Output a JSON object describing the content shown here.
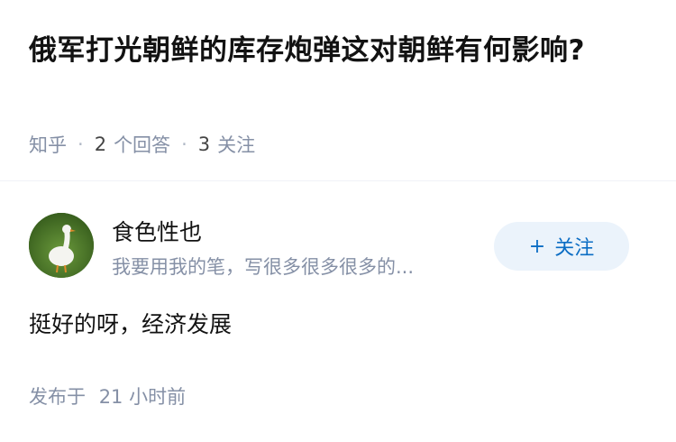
{
  "question": {
    "title": "俄军打光朝鲜的库存炮弹这对朝鲜有何影响?",
    "source": "知乎",
    "answer_count": "2",
    "answer_label": "个回答",
    "follow_count": "3",
    "follow_label": "关注"
  },
  "answer": {
    "author_name": "食色性也",
    "author_bio": "我要用我的笔，写很多很多很多的...",
    "avatar_icon": "goose-avatar",
    "follow_button": {
      "plus": "+",
      "label": "关注"
    },
    "content": "挺好的呀，经济发展",
    "published_prefix": "发布于",
    "published_time": "21 小时前"
  },
  "colors": {
    "meta": "#8590a6",
    "accent": "#0b6dc4",
    "button_bg": "#ebf3fb"
  }
}
